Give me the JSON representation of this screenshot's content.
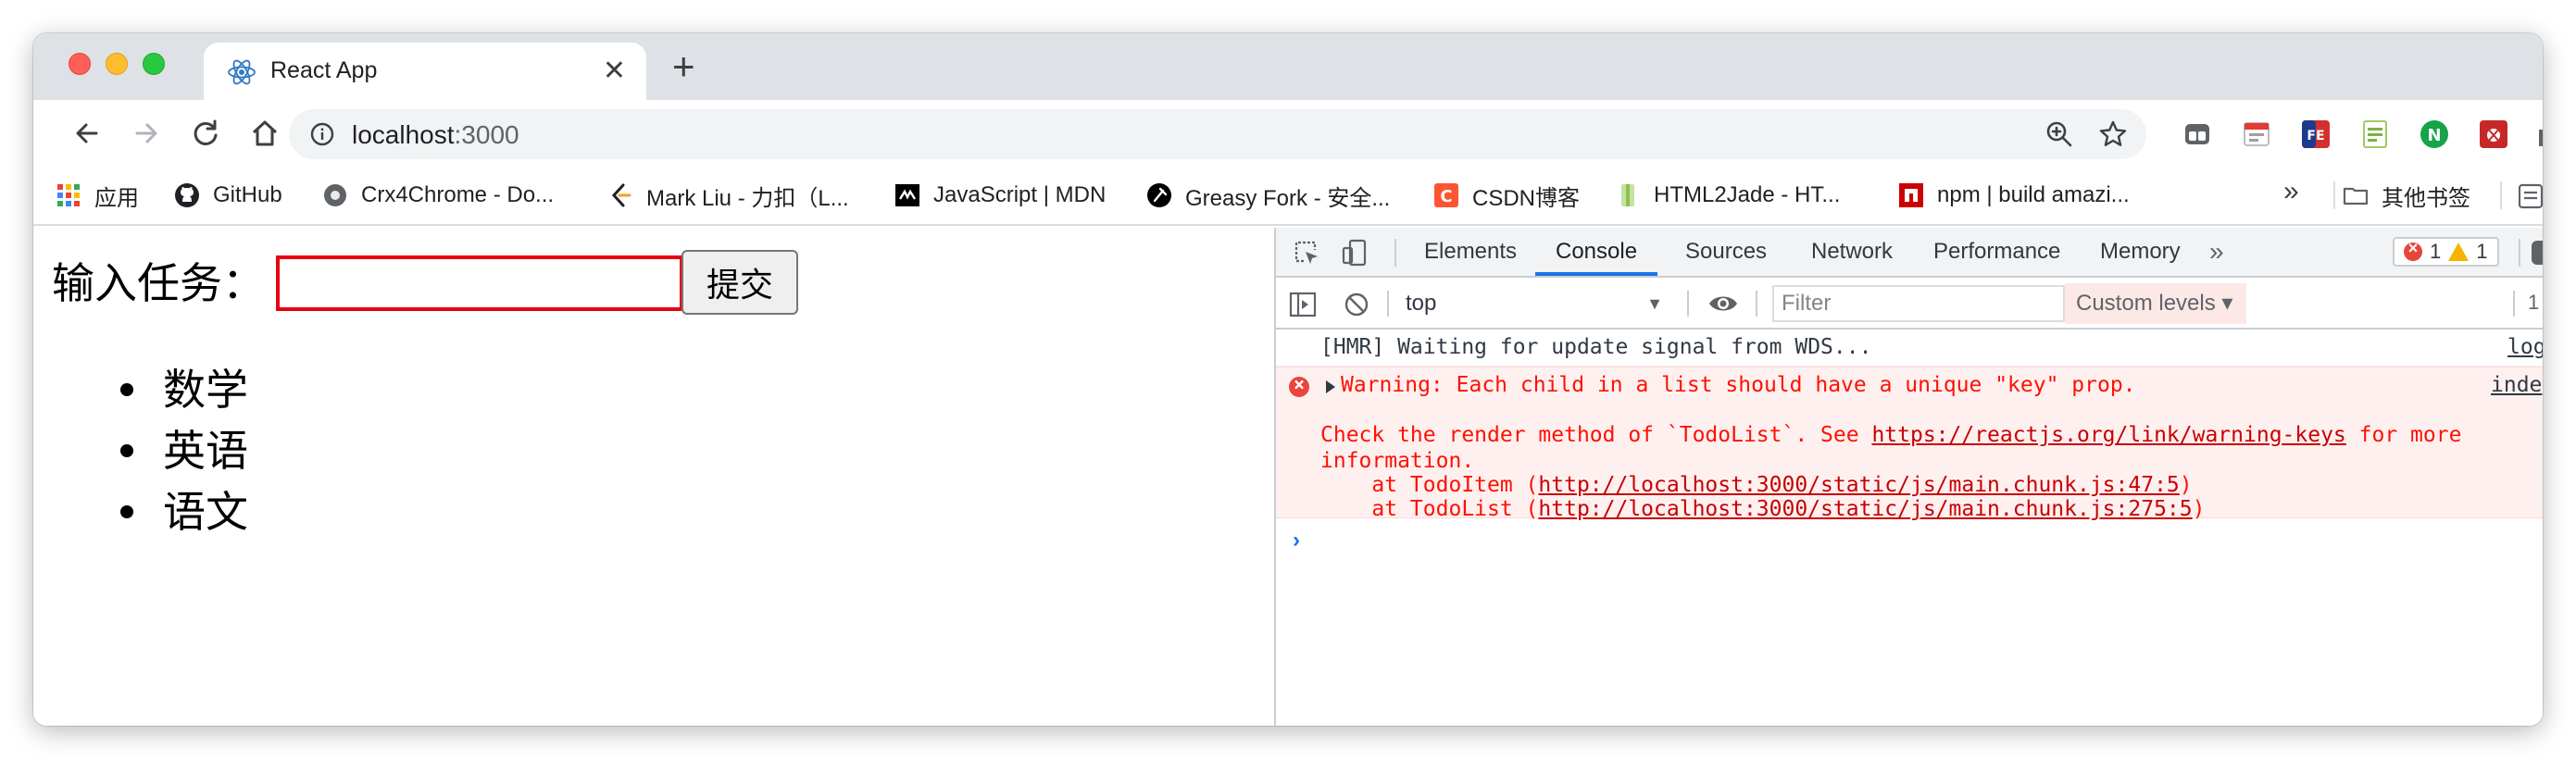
{
  "colors": {
    "close": "#ff5f57",
    "minimize": "#febc2e",
    "maximize": "#28c840",
    "input_border_error": "#e60012",
    "devtools_accent": "#1a73e8",
    "console_error": "#fe1100"
  },
  "tab": {
    "title": "React App",
    "favicon": "react-icon"
  },
  "address": {
    "host": "localhost",
    "port": ":3000"
  },
  "bookmarks": [
    {
      "label": "应用",
      "icon": "apps-grid-icon"
    },
    {
      "label": "GitHub",
      "icon": "github-icon"
    },
    {
      "label": "Crx4Chrome - Do...",
      "icon": "crx4chrome-icon"
    },
    {
      "label": "Mark Liu - 力扣（L...",
      "icon": "leetcode-icon"
    },
    {
      "label": "JavaScript | MDN",
      "icon": "mdn-icon"
    },
    {
      "label": "Greasy Fork - 安全...",
      "icon": "greasyfork-icon"
    },
    {
      "label": "CSDN博客",
      "icon": "csdn-icon"
    },
    {
      "label": "HTML2Jade - HT...",
      "icon": "html2jade-icon"
    },
    {
      "label": "npm | build amazi...",
      "icon": "npm-icon"
    }
  ],
  "bookmarks_more": "»",
  "other_bookmarks": "其他书签",
  "page": {
    "task_label": "输入任务：",
    "input_value": "",
    "submit_label": "提交",
    "todos": [
      "数学",
      "英语",
      "语文"
    ]
  },
  "devtools": {
    "tabs": [
      "Elements",
      "Console",
      "Sources",
      "Network",
      "Performance",
      "Memory"
    ],
    "active_tab": "Console",
    "more": "»",
    "error_count": "1",
    "warning_count": "1",
    "context": "top",
    "filter_placeholder": "Filter",
    "levels": "Custom levels ▾",
    "right_count": "1",
    "console": {
      "log_text": "[HMR] Waiting for update signal from WDS...",
      "log_source": "log",
      "error_line1": "Warning: Each child in a list should have a unique \"key\" prop.",
      "error_source": "inde",
      "error_line2_prefix": "Check the render method of `TodoList`. See ",
      "error_line2_link": "https://reactjs.org/link/warning-keys",
      "error_line2_suffix": " for more",
      "error_line3": "information.",
      "stack1_prefix": "    at TodoItem (",
      "stack1_link": "http://localhost:3000/static/js/main.chunk.js:47:5",
      "stack1_suffix": ")",
      "stack2_prefix": "    at TodoList (",
      "stack2_link": "http://localhost:3000/static/js/main.chunk.js:275:5",
      "stack2_suffix": ")",
      "prompt": "›"
    }
  }
}
